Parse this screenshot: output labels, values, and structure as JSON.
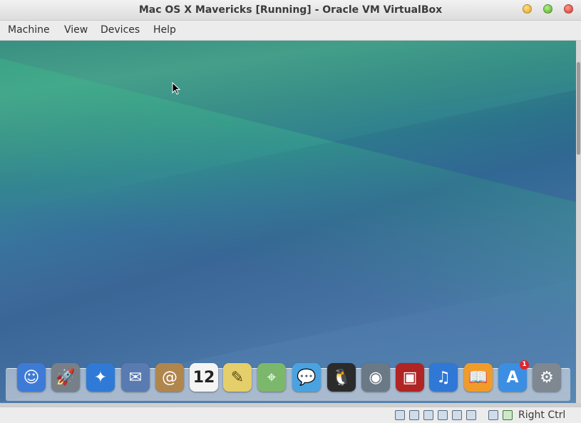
{
  "window": {
    "title": "Mac OS X Mavericks [Running] - Oracle VM VirtualBox"
  },
  "menu": {
    "items": [
      "Machine",
      "View",
      "Devices",
      "Help"
    ]
  },
  "dock": {
    "apps": [
      {
        "name": "finder",
        "glyph": "☺",
        "color": "#3e7bd6"
      },
      {
        "name": "launchpad",
        "glyph": "🚀",
        "color": "#777f88"
      },
      {
        "name": "safari",
        "glyph": "✦",
        "color": "#2f7ad6"
      },
      {
        "name": "mail",
        "glyph": "✉",
        "color": "#5a7bb2"
      },
      {
        "name": "contacts",
        "glyph": "@",
        "color": "#b0864d"
      },
      {
        "name": "calendar",
        "glyph": "12",
        "color": "#f4f4f4"
      },
      {
        "name": "notes",
        "glyph": "✎",
        "color": "#e5cf6a"
      },
      {
        "name": "maps",
        "glyph": "⌖",
        "color": "#7cb86c"
      },
      {
        "name": "messages",
        "glyph": "💬",
        "color": "#4aa3e0"
      },
      {
        "name": "qq",
        "glyph": "🐧",
        "color": "#2b2b2b"
      },
      {
        "name": "facetime",
        "glyph": "◉",
        "color": "#6b7886"
      },
      {
        "name": "photo-booth",
        "glyph": "▣",
        "color": "#b02424"
      },
      {
        "name": "itunes",
        "glyph": "♫",
        "color": "#2f78d6"
      },
      {
        "name": "ibooks",
        "glyph": "📖",
        "color": "#f19b2a"
      },
      {
        "name": "app-store",
        "glyph": "A",
        "color": "#3c8ee2"
      },
      {
        "name": "system-preferences",
        "glyph": "⚙",
        "color": "#7f8790"
      }
    ],
    "app_store_badge": "1"
  },
  "status": {
    "host_key": "Right Ctrl"
  }
}
